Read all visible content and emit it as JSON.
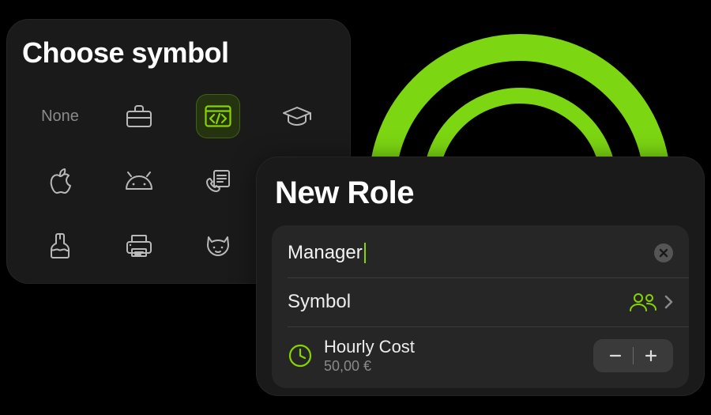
{
  "choose_panel": {
    "title": "Choose symbol",
    "symbols": [
      "none",
      "briefcase",
      "code",
      "graduation-cap",
      "apple",
      "android",
      "phone-document",
      "brush",
      "printer",
      "cat"
    ],
    "labels": {
      "none": "None"
    },
    "selected_symbol": "code"
  },
  "role_panel": {
    "title": "New Role",
    "name_value": "Manager",
    "symbol_row": {
      "label": "Symbol",
      "icon": "people"
    },
    "cost_row": {
      "label": "Hourly Cost",
      "value": "50,00 €"
    }
  },
  "colors": {
    "accent": "#86D400"
  }
}
